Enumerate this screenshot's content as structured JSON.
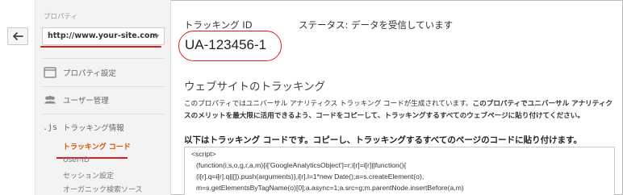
{
  "sidebar": {
    "property_label": "プロパティ",
    "property_value": "http://www.your-site.com",
    "items": [
      {
        "label": "プロパティ設定",
        "icon": "property-settings-icon"
      },
      {
        "label": "ユーザー管理",
        "icon": "users-icon"
      },
      {
        "label": "トラッキング情報",
        "icon": "js-icon",
        "icon_text": ".js"
      }
    ],
    "sub_items": [
      {
        "label": "トラッキング コード",
        "active": true
      },
      {
        "label": "User-ID",
        "active": false
      },
      {
        "label": "セッション設定",
        "active": false
      },
      {
        "label": "オーガニック検索ソース",
        "active": false
      }
    ]
  },
  "main": {
    "tracking_id_label": "トラッキング ID",
    "status": "ステータス: データを受信しています",
    "tracking_id": "UA-123456-1",
    "section_title": "ウェブサイトのトラッキング",
    "description_plain": "このプロパティではユニバーサル アナリティクス トラッキング コードが生成されています。",
    "description_bold": "このプロパティでユニバーサル アナリティクスのメリットを最大限に活用できるよう、コードをコピーして、トラッキングするすべてのウェブページに貼り付けてください。",
    "code_heading": "以下はトラッキング コードです。コピーし、トラッキングするすべてのページのコードに貼り付けます。",
    "code_lines": [
      "<script>",
      "(function(i,s,o,g,r,a,m){i['GoogleAnalyticsObject']=r;i[r]=i[r]||function(){",
      "(i[r].q=i[r].q||[]).push(arguments)},i[r].l=1*new Date();a=s.createElement(o),",
      "m=s.getElementsByTagName(o)[0];a.async=1;a.src=g;m.parentNode.insertBefore(a,m)"
    ]
  },
  "colors": {
    "highlight_red": "#d62020",
    "active_orange": "#d35400"
  }
}
